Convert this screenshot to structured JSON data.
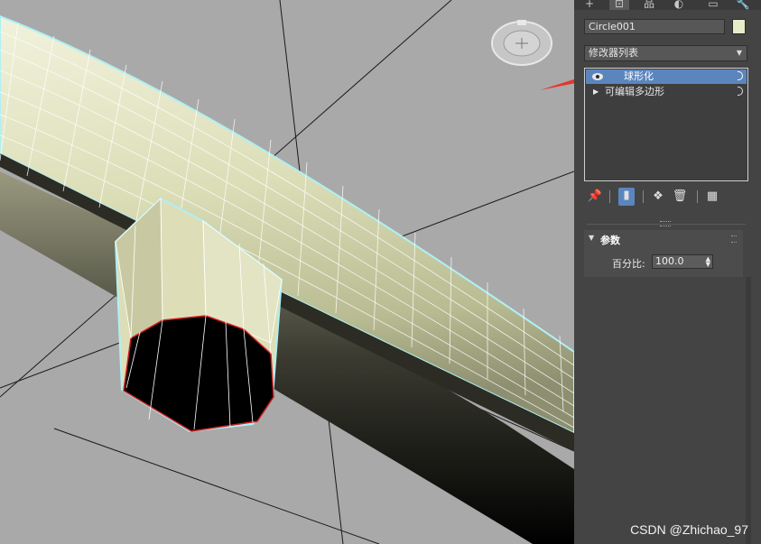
{
  "panel": {
    "tabs": [
      "+",
      "⊡",
      "品",
      "◐",
      "▭",
      "🔧"
    ],
    "object_name": "Circle001",
    "object_color": "#e8ecc8",
    "modifier_list_label": "修改器列表",
    "stack": [
      {
        "label": "球形化",
        "selected": true
      },
      {
        "label": "可编辑多边形",
        "selected": false
      }
    ],
    "toolbar_icons": [
      "pin-icon",
      "show-end-result-icon",
      "make-unique-icon",
      "remove-modifier-icon",
      "configure-sets-icon"
    ],
    "rollout": {
      "title": "参数",
      "param_label": "百分比:",
      "param_value": "100.0"
    }
  },
  "colors": {
    "accent": "#5b85bd",
    "panel_bg": "#444444",
    "viewport_bg": "#a9a9a9",
    "mesh_fill": "#e4e6c6",
    "arrow": "#e8332c"
  },
  "watermark": "CSDN @Zhichao_97"
}
